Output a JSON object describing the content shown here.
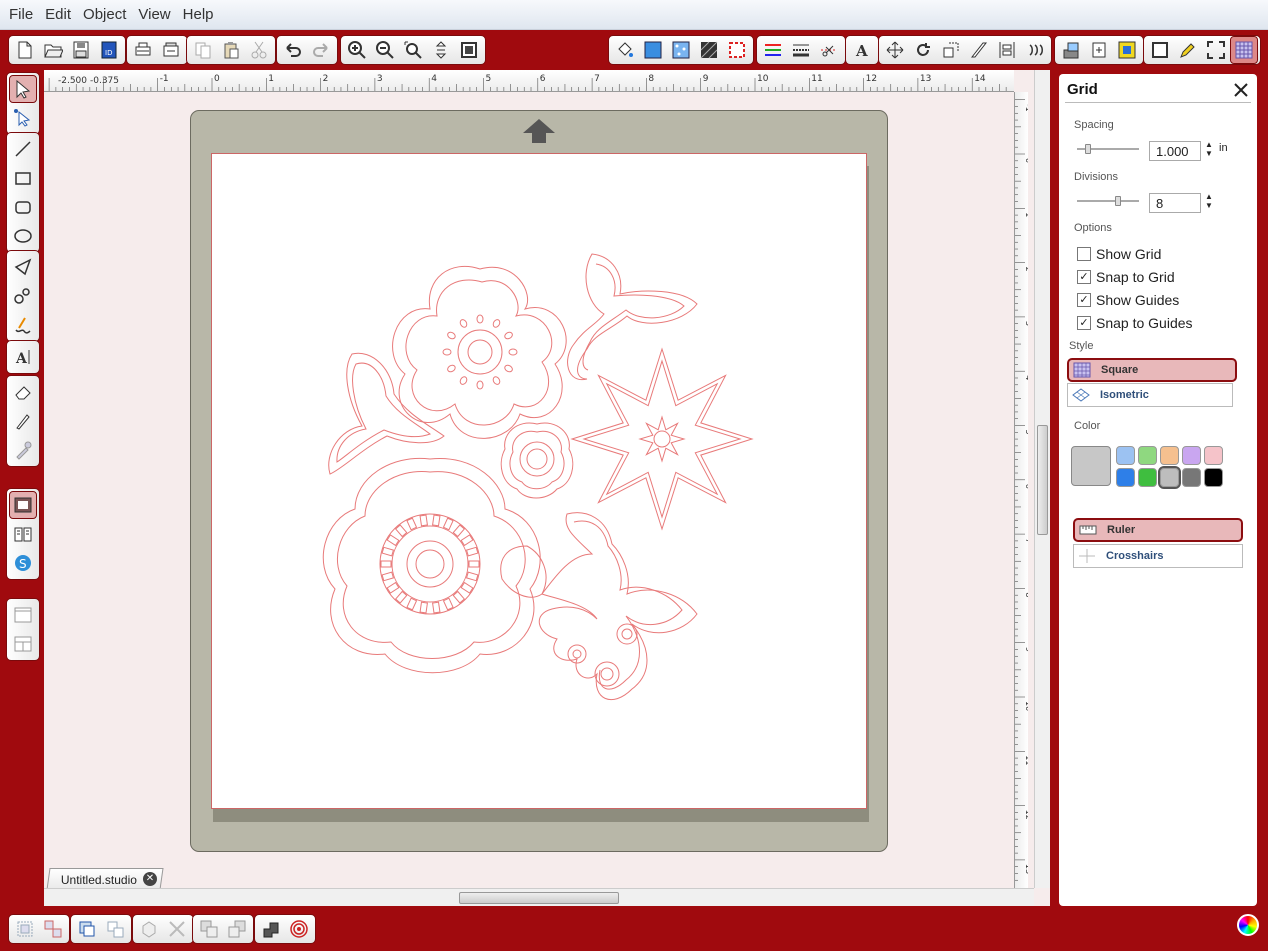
{
  "menu": [
    "File",
    "Edit",
    "Object",
    "View",
    "Help"
  ],
  "ruler": {
    "h_start_labels": [
      "-2.500",
      "-0.375"
    ],
    "h_ticks": [
      "-1",
      "0",
      "1",
      "2",
      "3",
      "4",
      "5",
      "6",
      "7",
      "8",
      "9",
      "10",
      "11",
      "12",
      "13",
      "14"
    ],
    "v_ticks": [
      "-1",
      "0",
      "1",
      "2",
      "3",
      "4",
      "5",
      "6",
      "7",
      "8",
      "9",
      "10",
      "11",
      "12",
      "13"
    ]
  },
  "document": {
    "tab_label": "Untitled.studio",
    "close_glyph": "✕"
  },
  "panel": {
    "title": "Grid",
    "spacing_label": "Spacing",
    "spacing_value": "1.000",
    "spacing_unit": "in",
    "divisions_label": "Divisions",
    "divisions_value": "8",
    "options_label": "Options",
    "options": [
      {
        "label": "Show Grid",
        "checked": false
      },
      {
        "label": "Snap to Grid",
        "checked": true
      },
      {
        "label": "Show Guides",
        "checked": true
      },
      {
        "label": "Snap to Guides",
        "checked": true
      }
    ],
    "style_label": "Style",
    "styles": [
      {
        "label": "Square",
        "active": true,
        "icon": "square-grid-icon"
      },
      {
        "label": "Isometric",
        "active": false,
        "icon": "isometric-grid-icon"
      }
    ],
    "color_label": "Color",
    "current_color": "#c7c7c7",
    "swatches_row1": [
      "#9cc2f2",
      "#8fd880",
      "#f5c08f",
      "#c9a6f0",
      "#f5c3c9"
    ],
    "swatches_row2": [
      "#2e7fe8",
      "#3fbe3f",
      "#bdbdbd",
      "#777777",
      "#000000"
    ],
    "rulers": [
      {
        "label": "Ruler",
        "active": true,
        "icon": "ruler-icon"
      },
      {
        "label": "Crosshairs",
        "active": false,
        "icon": "crosshairs-icon"
      }
    ]
  },
  "colors": {
    "chrome": "#a00a0e",
    "cut_line": "#e87a7a",
    "mat": "#b8b7a8",
    "workspace": "#f6ecec"
  }
}
